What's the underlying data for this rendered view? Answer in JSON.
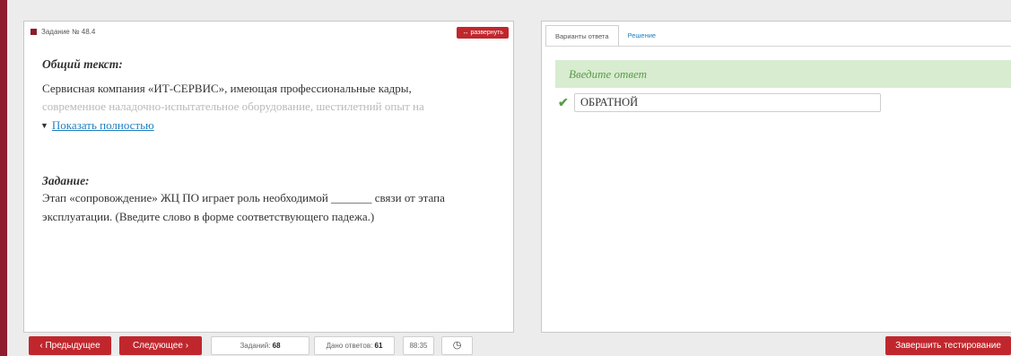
{
  "task": {
    "number_label": "Задание № 48.4",
    "expand_label": "развернуть",
    "common_title": "Общий текст:",
    "common_text": "Сервисная компания «ИТ-СЕРВИС», имеющая профессиональные кадры,",
    "common_text_faded": "современное наладочно-испытательное оборудование, шестилетний опыт на",
    "show_more_label": "Показать полностью",
    "task_title": "Задание:",
    "task_text": "Этап «сопровождение»  ЖЦ ПО играет роль необходимой _______ связи от этапа эксплуатации. (Введите слово в форме соответствующего падежа.)"
  },
  "answer": {
    "tabs": [
      {
        "label": "Варианты ответа"
      },
      {
        "label": "Решение"
      }
    ],
    "prompt": "Введите ответ",
    "value": "ОБРАТНОЙ"
  },
  "footer": {
    "prev_label": "Предыдущее",
    "next_label": "Следующее",
    "tasks_label": "Заданий:",
    "tasks_count": "68",
    "answers_label": "Дано ответов:",
    "answers_count": "61",
    "time": "88:35",
    "finish_label": "Завершить тестирование"
  },
  "colors": {
    "accent": "#c0272d",
    "success": "#5b9b4a",
    "link": "#1f7fc1"
  }
}
